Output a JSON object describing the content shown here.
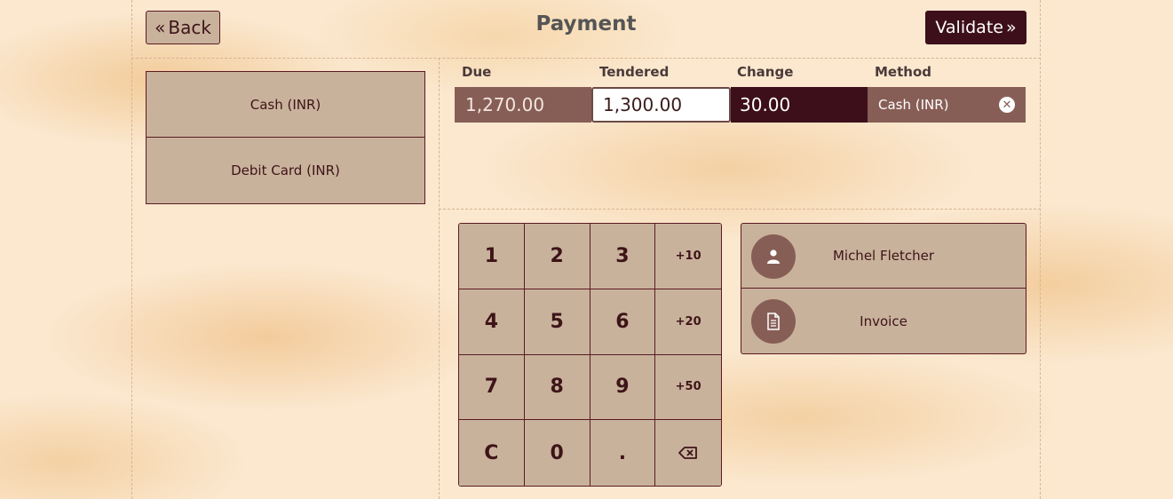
{
  "header": {
    "back_label": "Back",
    "title": "Payment",
    "validate_label": "Validate"
  },
  "payment_methods": [
    {
      "label": "Cash (INR)"
    },
    {
      "label": "Debit Card (INR)"
    }
  ],
  "paymentlines": {
    "headers": {
      "due": "Due",
      "tendered": "Tendered",
      "change": "Change",
      "method": "Method"
    },
    "line": {
      "due": "1,270.00",
      "tendered": "1,300.00",
      "change": "30.00",
      "method": "Cash (INR)"
    }
  },
  "numpad": {
    "keys": [
      "1",
      "2",
      "3",
      "+10",
      "4",
      "5",
      "6",
      "+20",
      "7",
      "8",
      "9",
      "+50",
      "C",
      "0",
      "."
    ]
  },
  "extras": {
    "customer_label": "Michel Fletcher",
    "invoice_label": "Invoice"
  },
  "colors": {
    "accent_dark": "#3c0f1a",
    "accent_mid": "#875e56",
    "button_bg": "#c9b29c",
    "border": "#5b1a22"
  }
}
